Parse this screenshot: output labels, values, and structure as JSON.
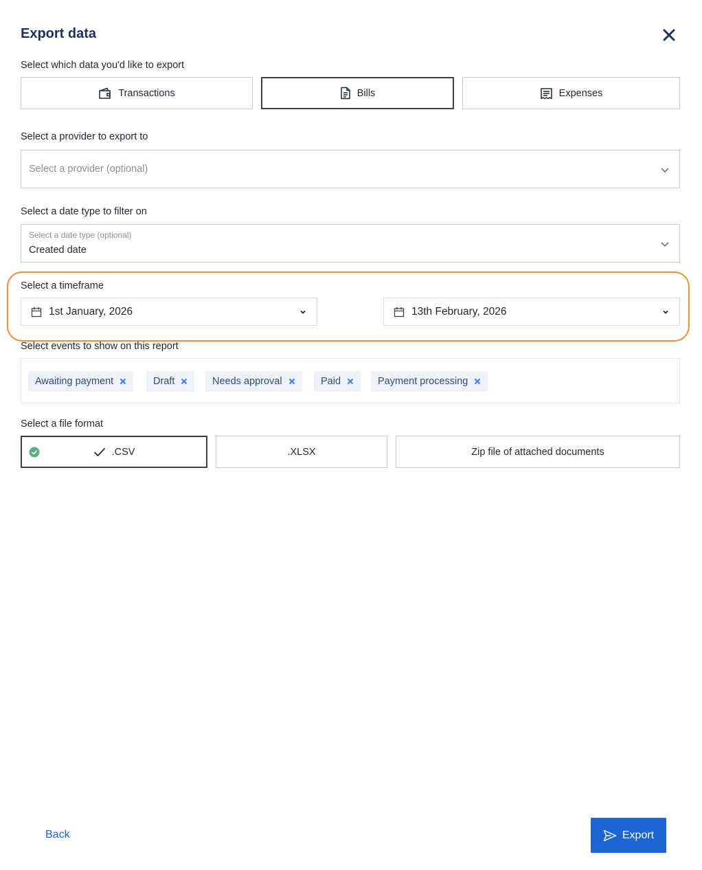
{
  "dialog": {
    "title": "Export data"
  },
  "data_type": {
    "label": "Select which data you'd like to export",
    "options": [
      {
        "label": "Transactions",
        "icon": "wallet-icon",
        "selected": false
      },
      {
        "label": "Bills",
        "icon": "document-icon",
        "selected": true
      },
      {
        "label": "Expenses",
        "icon": "receipt-icon",
        "selected": false
      }
    ]
  },
  "provider": {
    "label": "Select a provider to export to",
    "placeholder": "Select a provider (optional)",
    "value": ""
  },
  "date_type": {
    "label": "Select a date type to filter on",
    "placeholder": "Select a date type (optional)",
    "value": "Created date"
  },
  "timeframe": {
    "label": "Select a timeframe",
    "start": "1st January, 2026",
    "end": "13th February, 2026"
  },
  "events": {
    "label": "Select events to show on this report",
    "chips": [
      "Awaiting payment",
      "Draft",
      "Needs approval",
      "Paid",
      "Payment processing"
    ]
  },
  "file_format": {
    "label": "Select a file format",
    "options": [
      {
        "label": ".CSV",
        "selected": true
      },
      {
        "label": ".XLSX",
        "selected": false
      },
      {
        "label": "Zip file of attached documents",
        "selected": false
      }
    ]
  },
  "footer": {
    "back_label": "Back",
    "export_label": "Export"
  },
  "colors": {
    "title": "#1b3158",
    "primary": "#1b66d2",
    "highlight": "#ee8f36",
    "chip_bg": "#eef2f9",
    "chip_x": "#3f7be6",
    "success": "#5aae7c"
  }
}
